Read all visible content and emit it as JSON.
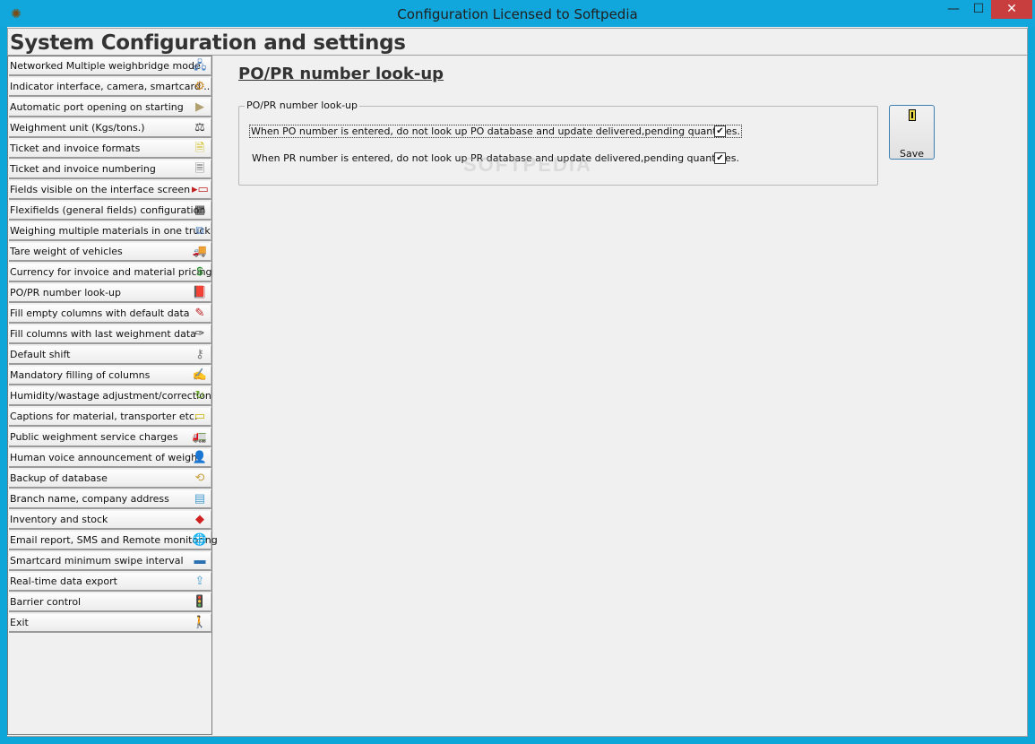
{
  "window": {
    "title": "Configuration  Licensed to Softpedia",
    "min_glyph": "—",
    "max_glyph": "☐",
    "close_glyph": "✕"
  },
  "header": {
    "title": "System Configuration and settings"
  },
  "sidebar": {
    "items": [
      {
        "label": "Networked Multiple weighbridge mode",
        "icon": "network-icon",
        "glyph": "🖧",
        "color": "#4a7fc1"
      },
      {
        "label": "Indicator interface, camera, smartcard ..",
        "icon": "gear-icon",
        "glyph": "⚙",
        "color": "#c8862a"
      },
      {
        "label": "Automatic port opening on starting",
        "icon": "port-icon",
        "glyph": "▶",
        "color": "#b0a070"
      },
      {
        "label": "Weighment unit (Kgs/tons.)",
        "icon": "scale-icon",
        "glyph": "⚖",
        "color": "#333333"
      },
      {
        "label": "Ticket and invoice formats",
        "icon": "document-icon",
        "glyph": "🗎",
        "color": "#c9b400"
      },
      {
        "label": "Ticket and invoice numbering",
        "icon": "numbered-document-icon",
        "glyph": "🗏",
        "color": "#555555"
      },
      {
        "label": "Fields visible on the interface screen",
        "icon": "fields-icon",
        "glyph": "▸▭",
        "color": "#c02020"
      },
      {
        "label": "Flexifields (general fields) configuration",
        "icon": "table-icon",
        "glyph": "▦",
        "color": "#333333"
      },
      {
        "label": "Weighing multiple materials in one truck",
        "icon": "copy-documents-icon",
        "glyph": "⧉",
        "color": "#4a7fc1"
      },
      {
        "label": "Tare weight of vehicles",
        "icon": "truck-icon",
        "glyph": "🚚",
        "color": "#c8a040"
      },
      {
        "label": "Currency for invoice and material pricing",
        "icon": "currency-icon",
        "glyph": "$",
        "color": "#1e8a1e"
      },
      {
        "label": "PO/PR number look-up",
        "icon": "book-icon",
        "glyph": "📕",
        "color": "#c01010"
      },
      {
        "label": "Fill empty columns with default data",
        "icon": "edit-document-icon",
        "glyph": "✎",
        "color": "#c02020"
      },
      {
        "label": "Fill columns with last weighment data",
        "icon": "fill-icon",
        "glyph": "✑",
        "color": "#333333"
      },
      {
        "label": "Default shift",
        "icon": "key-icon",
        "glyph": "⚷",
        "color": "#7a7a7a"
      },
      {
        "label": "Mandatory filling of columns",
        "icon": "pen-icon",
        "glyph": "✍",
        "color": "#a05020"
      },
      {
        "label": "Humidity/wastage adjustment/correction",
        "icon": "refresh-icon",
        "glyph": "↻",
        "color": "#60a020"
      },
      {
        "label": "Captions for material, transporter etc.",
        "icon": "caption-icon",
        "glyph": "▭",
        "color": "#c9b400"
      },
      {
        "label": "Public weighment service charges",
        "icon": "delivery-truck-icon",
        "glyph": "🚛",
        "color": "#d07010"
      },
      {
        "label": "Human voice announcement of weight",
        "icon": "person-icon",
        "glyph": "👤",
        "color": "#c02040"
      },
      {
        "label": "Backup of database",
        "icon": "backup-icon",
        "glyph": "⟲",
        "color": "#c8a040"
      },
      {
        "label": "Branch name, company address",
        "icon": "address-icon",
        "glyph": "▤",
        "color": "#4a9fd1"
      },
      {
        "label": "Inventory and stock",
        "icon": "inventory-icon",
        "glyph": "◆",
        "color": "#d02020"
      },
      {
        "label": "Email report, SMS and Remote monitoring",
        "icon": "globe-icon",
        "glyph": "🌐",
        "color": "#1e7a3e"
      },
      {
        "label": "Smartcard minimum swipe interval",
        "icon": "card-icon",
        "glyph": "▬",
        "color": "#2a6fb1"
      },
      {
        "label": "Real-time data export",
        "icon": "export-icon",
        "glyph": "⇪",
        "color": "#4a9fd1"
      },
      {
        "label": "Barrier control",
        "icon": "traffic-light-icon",
        "glyph": "🚦",
        "color": "#222222"
      },
      {
        "label": "Exit",
        "icon": "exit-icon",
        "glyph": "🚶",
        "color": "#4a7fc1"
      }
    ]
  },
  "main": {
    "section_title": "PO/PR number look-up",
    "groupbox_label": "PO/PR number look-up",
    "options": [
      {
        "label": "When PO number is entered, do not look up PO database and update delivered,pending quantities.",
        "checked": true
      },
      {
        "label": "When PR number is entered, do not look up PR database and update delivered,pending quantities.",
        "checked": true
      }
    ],
    "check_glyph": "✔",
    "save_label": "Save",
    "watermark": "SOFTPEDIA"
  }
}
